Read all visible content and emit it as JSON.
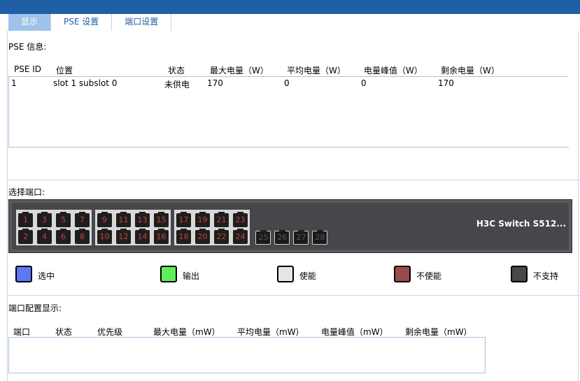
{
  "tabs": [
    {
      "label": "显示",
      "active": true
    },
    {
      "label": "PSE 设置",
      "active": false
    },
    {
      "label": "端口设置",
      "active": false
    }
  ],
  "pse_section": {
    "title": "PSE 信息:",
    "columns": [
      "PSE ID",
      "位置",
      "状态",
      "最大电量（W）",
      "平均电量（W）",
      "电量峰值（W）",
      "剩余电量（W）"
    ],
    "rows": [
      {
        "id": "1",
        "location": "slot 1 subslot 0",
        "status": "未供电",
        "max": "170",
        "avg": "0",
        "peak": "0",
        "remaining": "170"
      }
    ]
  },
  "port_select": {
    "title": "选择端口:",
    "switch_name": "H3C Switch S512...",
    "ports_top": [
      "1",
      "3",
      "5",
      "7",
      "9",
      "11",
      "13",
      "15",
      "17",
      "19",
      "21",
      "23"
    ],
    "ports_bottom": [
      "2",
      "4",
      "6",
      "8",
      "10",
      "12",
      "14",
      "16",
      "18",
      "20",
      "22",
      "24"
    ],
    "ports_unsupported": [
      "25",
      "26",
      "27",
      "28"
    ]
  },
  "legend": [
    {
      "label": "选中",
      "color": "#5b78f5",
      "icon": "selected-swatch-icon"
    },
    {
      "label": "输出",
      "color": "#5ef05a",
      "icon": "output-swatch-icon"
    },
    {
      "label": "使能",
      "color": "#e6e6e6",
      "icon": "enabled-swatch-icon"
    },
    {
      "label": "不使能",
      "color": "#9a4b4b",
      "icon": "disabled-swatch-icon"
    },
    {
      "label": "不支持",
      "color": "#4a4747",
      "icon": "unsupported-swatch-icon"
    }
  ],
  "port_config": {
    "title": "端口配置显示:",
    "columns": [
      "端口",
      "状态",
      "优先级",
      "最大电量（mW）",
      "平均电量（mW）",
      "电量峰值（mW）",
      "剩余电量（mW）"
    ]
  },
  "colors": {
    "topbar": "#1f5fa6",
    "active_tab": "#9fc2ea",
    "switch_body": "#47464a",
    "port_label": "#c8403a"
  }
}
